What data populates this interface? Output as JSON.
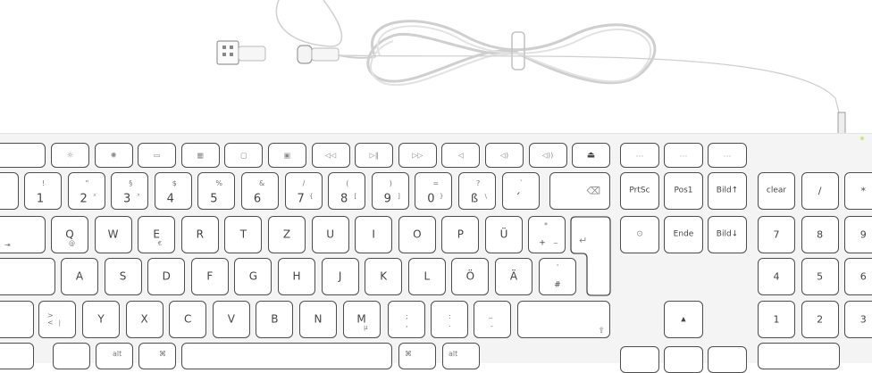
{
  "product": {
    "name": "White aluminium keyboard with USB cable, German layout"
  },
  "keyboard": {
    "fn_row": [
      "",
      "",
      "",
      "",
      "",
      "",
      "",
      "",
      "",
      "",
      "",
      "",
      "",
      "⏏"
    ],
    "fn_icons": [
      "brightness-down-icon",
      "brightness-up-icon",
      "mission-control-icon",
      "launchpad-icon",
      "screenshot-icon",
      "screenshot-region-icon",
      "rewind-icon",
      "play-pause-icon",
      "fast-forward-icon",
      "mute-icon",
      "volume-down-icon",
      "volume-up-icon"
    ],
    "number_row": [
      {
        "main": "1",
        "top": "!"
      },
      {
        "main": "2",
        "top": "\"",
        "sub": "²"
      },
      {
        "main": "3",
        "top": "§",
        "sub": "³"
      },
      {
        "main": "4",
        "top": "$"
      },
      {
        "main": "5",
        "top": "%"
      },
      {
        "main": "6",
        "top": "&"
      },
      {
        "main": "7",
        "top": "/",
        "sub": "{"
      },
      {
        "main": "8",
        "top": "(",
        "sub": "["
      },
      {
        "main": "9",
        "top": ")",
        "sub": "]"
      },
      {
        "main": "0",
        "top": "=",
        "sub": "}"
      },
      {
        "main": "ß",
        "top": "?",
        "sub": "\\"
      },
      {
        "main": "´",
        "top": "`"
      }
    ],
    "qwertz_row": [
      "Q",
      "W",
      "E",
      "R",
      "T",
      "Z",
      "U",
      "I",
      "O",
      "P",
      "Ü"
    ],
    "qwertz_subs": {
      "Q": "@",
      "E": "€"
    },
    "plus_key": {
      "top": "*",
      "main": "+",
      "sub": "~"
    },
    "asdf_row": [
      "A",
      "S",
      "D",
      "F",
      "G",
      "H",
      "J",
      "K",
      "L",
      "Ö",
      "Ä"
    ],
    "hash_key": {
      "top": "'",
      "main": "#"
    },
    "yxcv_row": [
      "Y",
      "X",
      "C",
      "V",
      "B",
      "N",
      "M"
    ],
    "m_sub": "µ",
    "angle_key": {
      "top": ">",
      "main": "<",
      "sub": "|"
    },
    "comma_key": {
      "top": ";",
      "main": ","
    },
    "dot_key": {
      "top": ":",
      "main": "."
    },
    "dash_key": {
      "top": "_",
      "main": "-"
    },
    "bottom_row": {
      "alt_left": "alt",
      "cmd_left": "⌘",
      "cmd_right": "⌘",
      "alt_right": "alt"
    },
    "nav_row1": [
      "PrtSc",
      "Pos1",
      "Bild↑"
    ],
    "nav_row2": [
      "Ende",
      "Bild↓"
    ],
    "nav_top_icons": [
      "…",
      "…",
      "…"
    ],
    "arrow_up": "▲",
    "numpad": {
      "row0": [
        "clear",
        "/",
        "*"
      ],
      "row1": [
        "7",
        "8",
        "9"
      ],
      "row2": [
        "4",
        "5",
        "6"
      ],
      "row3": [
        "1",
        "2",
        "3"
      ]
    },
    "symbols": {
      "backspace": "⌫",
      "tab": "⇥",
      "enter": "↵",
      "shift": "⇧",
      "eject": "⏏",
      "insert": "⊙"
    }
  }
}
